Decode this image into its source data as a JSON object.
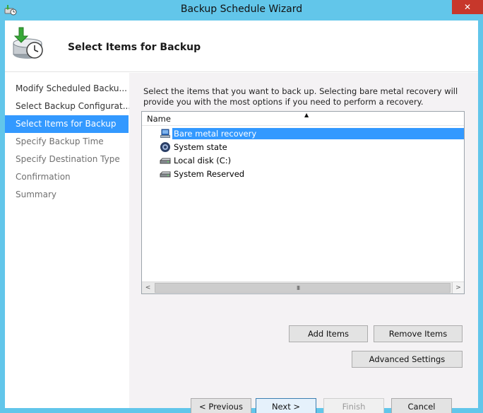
{
  "window": {
    "title": "Backup Schedule Wizard",
    "close_glyph": "✕"
  },
  "header": {
    "heading": "Select Items for Backup"
  },
  "nav": {
    "items": [
      {
        "label": "Modify Scheduled Backu...",
        "state": "done"
      },
      {
        "label": "Select Backup Configurat...",
        "state": "done"
      },
      {
        "label": "Select Items for Backup",
        "state": "selected"
      },
      {
        "label": "Specify Backup Time",
        "state": "future"
      },
      {
        "label": "Specify Destination Type",
        "state": "future"
      },
      {
        "label": "Confirmation",
        "state": "future"
      },
      {
        "label": "Summary",
        "state": "future"
      }
    ]
  },
  "content": {
    "description": "Select the items that you want to back up. Selecting bare metal recovery will provide you with the most options if you need to perform a recovery.",
    "list": {
      "column_header": "Name",
      "sort_glyph": "▲",
      "items": [
        {
          "label": "Bare metal recovery",
          "icon": "bare-metal-recovery-icon",
          "selected": true
        },
        {
          "label": "System state",
          "icon": "system-state-icon",
          "selected": false
        },
        {
          "label": "Local disk (C:)",
          "icon": "disk-drive-icon",
          "selected": false
        },
        {
          "label": "System Reserved",
          "icon": "disk-drive-icon",
          "selected": false
        }
      ],
      "scroll_left_glyph": "<",
      "scroll_right_glyph": ">",
      "scroll_grip_glyph": "III"
    },
    "buttons": {
      "add_items": "Add Items",
      "remove_items": "Remove Items",
      "advanced_settings": "Advanced Settings"
    }
  },
  "footer": {
    "previous": "< Previous",
    "next": "Next >",
    "finish": "Finish",
    "cancel": "Cancel"
  },
  "colors": {
    "titlebar": "#62c6ea",
    "selection": "#3399ff",
    "close_button": "#c7372b"
  }
}
